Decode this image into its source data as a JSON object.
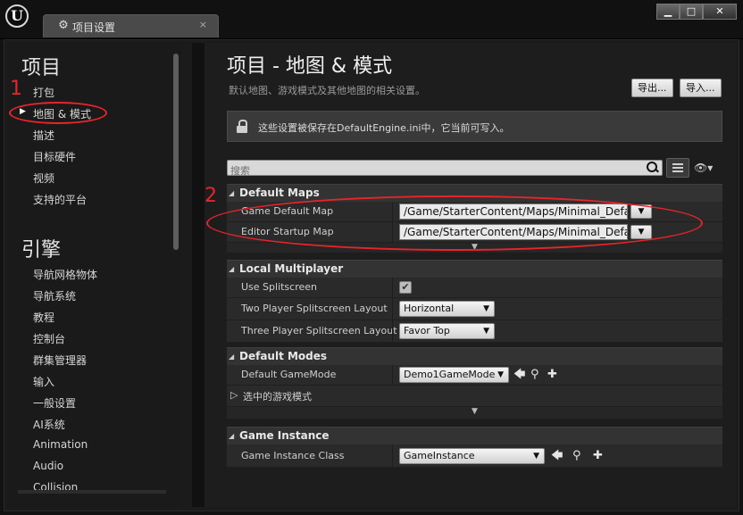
{
  "window": {
    "tab_title": "项目设置",
    "tab_close": "×",
    "controls": [
      "▁",
      "□",
      "✕"
    ]
  },
  "sidebar": {
    "project_heading": "项目",
    "project_items": [
      {
        "label": "打包"
      },
      {
        "label": "地图 & 模式"
      },
      {
        "label": "描述"
      },
      {
        "label": "目标硬件"
      },
      {
        "label": "视频"
      },
      {
        "label": "支持的平台"
      }
    ],
    "engine_heading": "引擎",
    "engine_items": [
      {
        "label": "导航网格物体"
      },
      {
        "label": "导航系统"
      },
      {
        "label": "教程"
      },
      {
        "label": "控制台"
      },
      {
        "label": "群集管理器"
      },
      {
        "label": "输入"
      },
      {
        "label": "一般设置"
      },
      {
        "label": "AI系统"
      },
      {
        "label": "Animation"
      },
      {
        "label": "Audio"
      },
      {
        "label": "Collision"
      }
    ]
  },
  "header": {
    "title": "项目 - 地图 & 模式",
    "subtitle": "默认地图、游戏模式及其他地图的相关设置。",
    "export_label": "导出...",
    "import_label": "导入..."
  },
  "notice": {
    "text": "这些设置被保存在DefaultEngine.ini中，它当前可写入。"
  },
  "search": {
    "placeholder": "搜索",
    "view_label": "👁▾"
  },
  "sections": {
    "default_maps": {
      "title": "Default Maps",
      "game_default_map_label": "Game Default Map",
      "game_default_map_value": "/Game/StarterContent/Maps/Minimal_Default",
      "editor_startup_map_label": "Editor Startup Map",
      "editor_startup_map_value": "/Game/StarterContent/Maps/Minimal_Default"
    },
    "local_multiplayer": {
      "title": "Local Multiplayer",
      "use_splitscreen_label": "Use Splitscreen",
      "use_splitscreen_checked": "✔",
      "two_player_label": "Two Player Splitscreen Layout",
      "two_player_value": "Horizontal",
      "three_player_label": "Three Player Splitscreen Layout",
      "three_player_value": "Favor Top"
    },
    "default_modes": {
      "title": "Default Modes",
      "default_gamemode_label": "Default GameMode",
      "default_gamemode_value": "Demo1GameMode",
      "selected_gamemode_label": "选中的游戏模式"
    },
    "game_instance": {
      "title": "Game Instance",
      "game_instance_class_label": "Game Instance Class",
      "game_instance_class_value": "GameInstance"
    }
  },
  "annotations": {
    "marker_1": "1",
    "marker_2": "2",
    "color": "#e8242a"
  },
  "colors": {
    "background": "#1d1d1d",
    "section_header": "#333333",
    "annotation_red": "#e8242a"
  }
}
